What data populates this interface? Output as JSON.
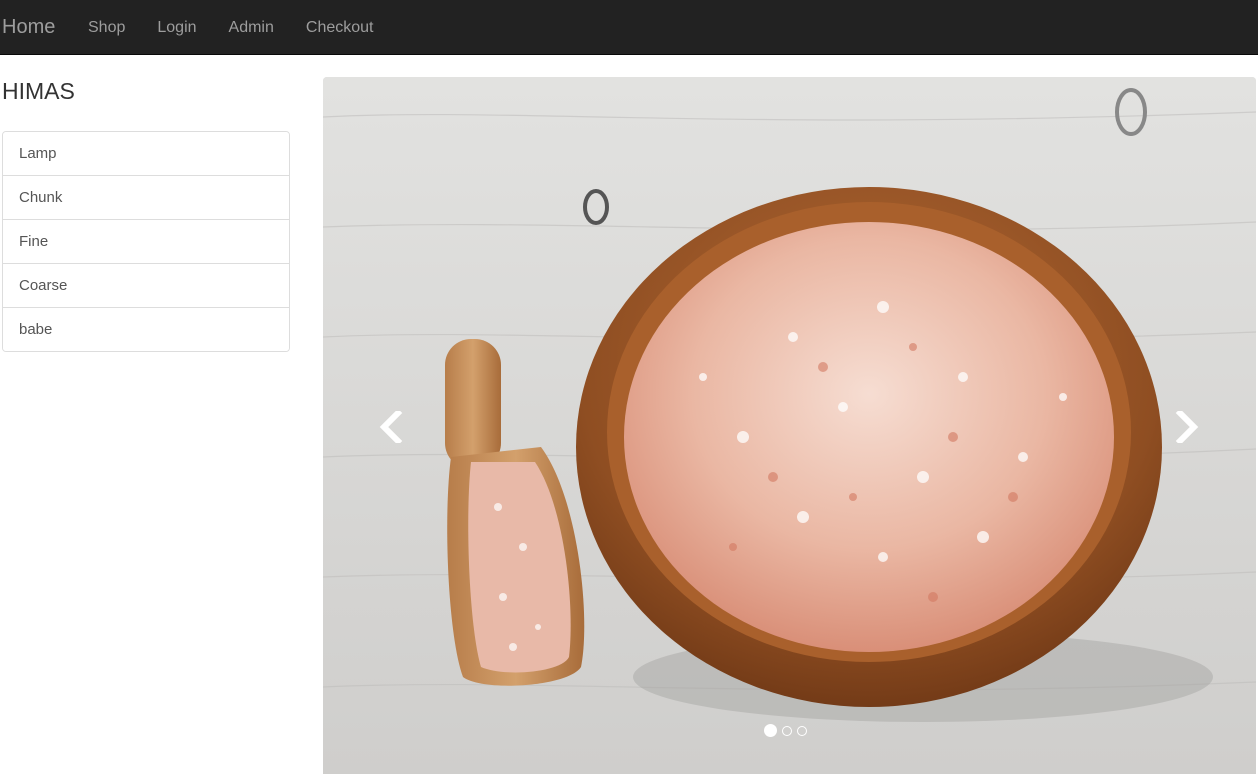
{
  "navbar": {
    "brand": "Home",
    "links": [
      "Shop",
      "Login",
      "Admin",
      "Checkout"
    ]
  },
  "sidebar": {
    "title": "HIMAS",
    "categories": [
      "Lamp",
      "Chunk",
      "Fine",
      "Coarse",
      "babe"
    ]
  },
  "carousel": {
    "slide_image": "himalayan-pink-salt-bowl-photo",
    "prev_icon": "chevron-left-icon",
    "next_icon": "chevron-right-icon",
    "slide_count": 3,
    "active_slide": 1
  },
  "colors": {
    "navbar_bg": "#222222",
    "nav_text": "#9d9d9d",
    "list_border": "#dddddd"
  }
}
